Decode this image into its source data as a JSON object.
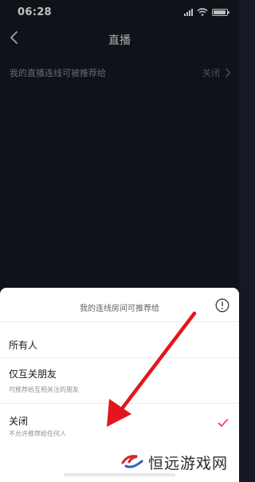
{
  "status_bar": {
    "time": "06:28",
    "icons": [
      "signal-icon",
      "wifi-icon",
      "battery-icon"
    ]
  },
  "header": {
    "title": "直播",
    "back_icon": "back-icon"
  },
  "setting": {
    "label": "我的直播连线可被推荐给",
    "value": "关闭",
    "chevron_icon": "chevron-right-icon"
  },
  "sheet": {
    "title": "我的连线房间可推荐给",
    "info_icon": "info-icon",
    "options": [
      {
        "label": "所有人",
        "description": "",
        "selected": false
      },
      {
        "label": "仅互关朋友",
        "description": "可推荐给互相关注的朋友",
        "selected": false
      },
      {
        "label": "关闭",
        "description": "不允许推荐给任何人",
        "selected": true
      }
    ]
  },
  "watermark": {
    "text": "恒远游戏网"
  },
  "colors": {
    "background": "#161823",
    "sheet_background": "#ffffff",
    "check": "#fe2c55",
    "annotation_arrow": "#e3161d"
  }
}
